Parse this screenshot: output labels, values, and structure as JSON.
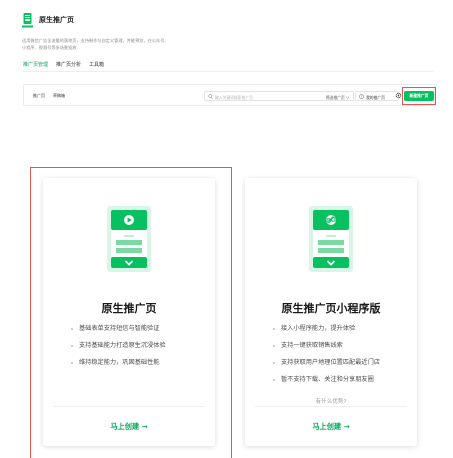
{
  "header": {
    "title": "原生推广页",
    "description": "适用微信广告全流量的落地页，支持制作与自定义管理，并能预览，在公众号、小程序、视频号等多场景投放"
  },
  "tabs": [
    {
      "label": "推广页管理",
      "active": true
    },
    {
      "label": "推广页分析",
      "active": false
    },
    {
      "label": "工具箱",
      "active": false
    }
  ],
  "toolbar": {
    "subtabs": [
      "推广页",
      "草稿箱"
    ],
    "search_placeholder": "输入关键词搜索推广页",
    "filter_label": "筛选推广页",
    "hint_label": "我的推广页",
    "new_button": "新建推广页"
  },
  "cards": [
    {
      "title": "原生推广页",
      "illustration": "play-icon",
      "features": [
        "基础表单支持短信与智能验证",
        "支持基础能力打造原生沉浸体验",
        "维持稳定能力，巩固基础性能"
      ],
      "why": "",
      "create": "马上创建 →"
    },
    {
      "title": "原生推广页小程序版",
      "illustration": "link-icon",
      "features": [
        "接入小程序能力，提升体验",
        "支持一键获取销售线索",
        "支持获取用户地理位置匹配最近门店",
        "暂不支持下载、关注和分享朋友圈"
      ],
      "why": "有什么优势?",
      "create": "马上创建 →"
    }
  ],
  "colors": {
    "accent": "#07c160",
    "accent_text": "#07a85e",
    "highlight_frame": "#e0584f"
  }
}
